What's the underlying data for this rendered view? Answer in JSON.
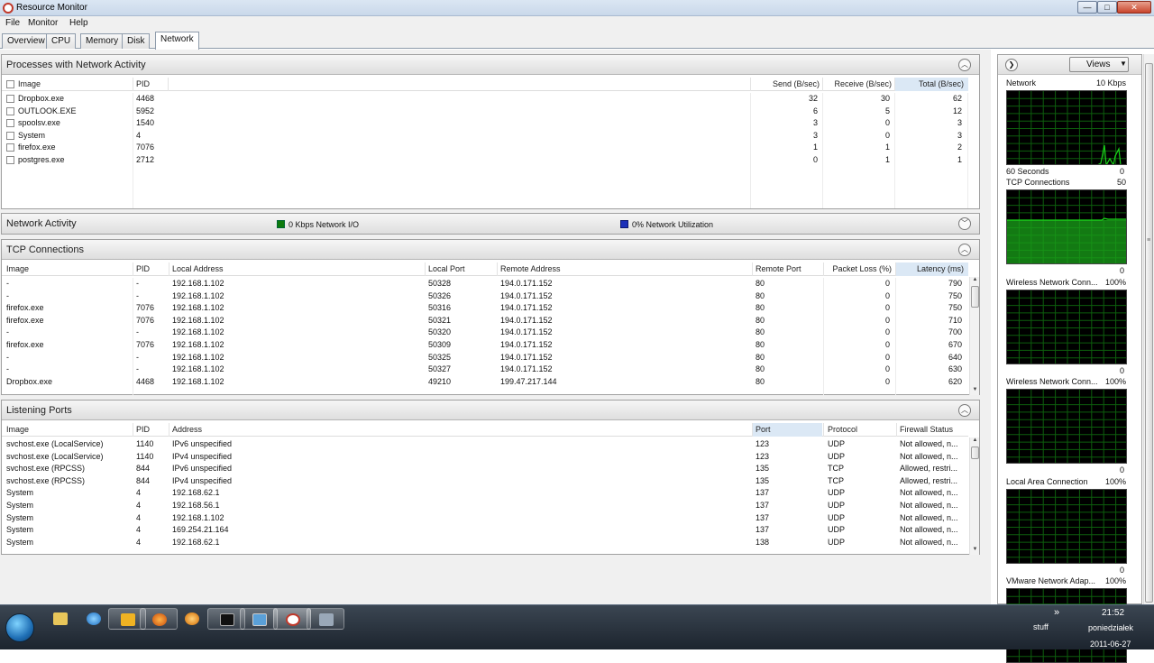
{
  "window": {
    "title": "Resource Monitor",
    "min": "—",
    "max": "□",
    "close": "✕"
  },
  "menu": [
    "File",
    "Monitor",
    "Help"
  ],
  "tabs": [
    "Overview",
    "CPU",
    "Memory",
    "Disk",
    "Network"
  ],
  "active_tab": "Network",
  "colors": {
    "graph_line": "#19d419",
    "graph_grid": "#0d5e0d",
    "graph_fill": "#1aa31a",
    "net_io": "#0c7a0c",
    "net_util": "#1b2fb8"
  },
  "processes": {
    "title": "Processes with Network Activity",
    "headers": [
      "Image",
      "PID",
      "Send (B/sec)",
      "Receive (B/sec)",
      "Total (B/sec)"
    ],
    "rows": [
      [
        "Dropbox.exe",
        "4468",
        "32",
        "30",
        "62"
      ],
      [
        "OUTLOOK.EXE",
        "5952",
        "6",
        "5",
        "12"
      ],
      [
        "spoolsv.exe",
        "1540",
        "3",
        "0",
        "3"
      ],
      [
        "System",
        "4",
        "3",
        "0",
        "3"
      ],
      [
        "firefox.exe",
        "7076",
        "1",
        "1",
        "2"
      ],
      [
        "postgres.exe",
        "2712",
        "0",
        "1",
        "1"
      ]
    ]
  },
  "network_activity": {
    "title": "Network Activity",
    "io": "0 Kbps Network I/O",
    "util": "0% Network Utilization"
  },
  "tcp": {
    "title": "TCP Connections",
    "headers": [
      "Image",
      "PID",
      "Local Address",
      "Local Port",
      "Remote Address",
      "Remote Port",
      "Packet Loss (%)",
      "Latency (ms)"
    ],
    "rows": [
      [
        "-",
        "-",
        "192.168.1.102",
        "50328",
        "194.0.171.152",
        "80",
        "0",
        "790"
      ],
      [
        "-",
        "-",
        "192.168.1.102",
        "50326",
        "194.0.171.152",
        "80",
        "0",
        "750"
      ],
      [
        "firefox.exe",
        "7076",
        "192.168.1.102",
        "50316",
        "194.0.171.152",
        "80",
        "0",
        "750"
      ],
      [
        "firefox.exe",
        "7076",
        "192.168.1.102",
        "50321",
        "194.0.171.152",
        "80",
        "0",
        "710"
      ],
      [
        "-",
        "-",
        "192.168.1.102",
        "50320",
        "194.0.171.152",
        "80",
        "0",
        "700"
      ],
      [
        "firefox.exe",
        "7076",
        "192.168.1.102",
        "50309",
        "194.0.171.152",
        "80",
        "0",
        "670"
      ],
      [
        "-",
        "-",
        "192.168.1.102",
        "50325",
        "194.0.171.152",
        "80",
        "0",
        "640"
      ],
      [
        "-",
        "-",
        "192.168.1.102",
        "50327",
        "194.0.171.152",
        "80",
        "0",
        "630"
      ],
      [
        "Dropbox.exe",
        "4468",
        "192.168.1.102",
        "49210",
        "199.47.217.144",
        "80",
        "0",
        "620"
      ]
    ]
  },
  "listening": {
    "title": "Listening Ports",
    "headers": [
      "Image",
      "PID",
      "Address",
      "Port",
      "Protocol",
      "Firewall Status"
    ],
    "rows": [
      [
        "svchost.exe (LocalService)",
        "1140",
        "IPv6 unspecified",
        "123",
        "UDP",
        "Not allowed, n..."
      ],
      [
        "svchost.exe (LocalService)",
        "1140",
        "IPv4 unspecified",
        "123",
        "UDP",
        "Not allowed, n..."
      ],
      [
        "svchost.exe (RPCSS)",
        "844",
        "IPv6 unspecified",
        "135",
        "TCP",
        "Allowed, restri..."
      ],
      [
        "svchost.exe (RPCSS)",
        "844",
        "IPv4 unspecified",
        "135",
        "TCP",
        "Allowed, restri..."
      ],
      [
        "System",
        "4",
        "192.168.62.1",
        "137",
        "UDP",
        "Not allowed, n..."
      ],
      [
        "System",
        "4",
        "192.168.56.1",
        "137",
        "UDP",
        "Not allowed, n..."
      ],
      [
        "System",
        "4",
        "192.168.1.102",
        "137",
        "UDP",
        "Not allowed, n..."
      ],
      [
        "System",
        "4",
        "169.254.21.164",
        "137",
        "UDP",
        "Not allowed, n..."
      ],
      [
        "System",
        "4",
        "192.168.62.1",
        "138",
        "UDP",
        "Not allowed, n..."
      ]
    ]
  },
  "right_pane": {
    "views_label": "Views",
    "graphs": [
      {
        "title": "Network",
        "scale": "10 Kbps",
        "footer_left": "60 Seconds",
        "footer_right": "0",
        "kind": "spike"
      },
      {
        "title": "TCP Connections",
        "scale": "50",
        "footer_left": "",
        "footer_right": "0",
        "kind": "level"
      },
      {
        "title": "Wireless Network Conn...",
        "scale": "100%",
        "footer_left": "",
        "footer_right": "0",
        "kind": "empty"
      },
      {
        "title": "Wireless Network Conn...",
        "scale": "100%",
        "footer_left": "",
        "footer_right": "0",
        "kind": "empty"
      },
      {
        "title": "Local Area Connection",
        "scale": "100%",
        "footer_left": "",
        "footer_right": "0",
        "kind": "empty"
      },
      {
        "title": "VMware Network Adap...",
        "scale": "100%",
        "footer_left": "",
        "footer_right": "",
        "kind": "empty"
      }
    ]
  },
  "taskbar": {
    "tray_label": "stuff",
    "tray_chevron": "»",
    "time": "21:52",
    "day": "poniedziałek",
    "date": "2011-06-27"
  }
}
